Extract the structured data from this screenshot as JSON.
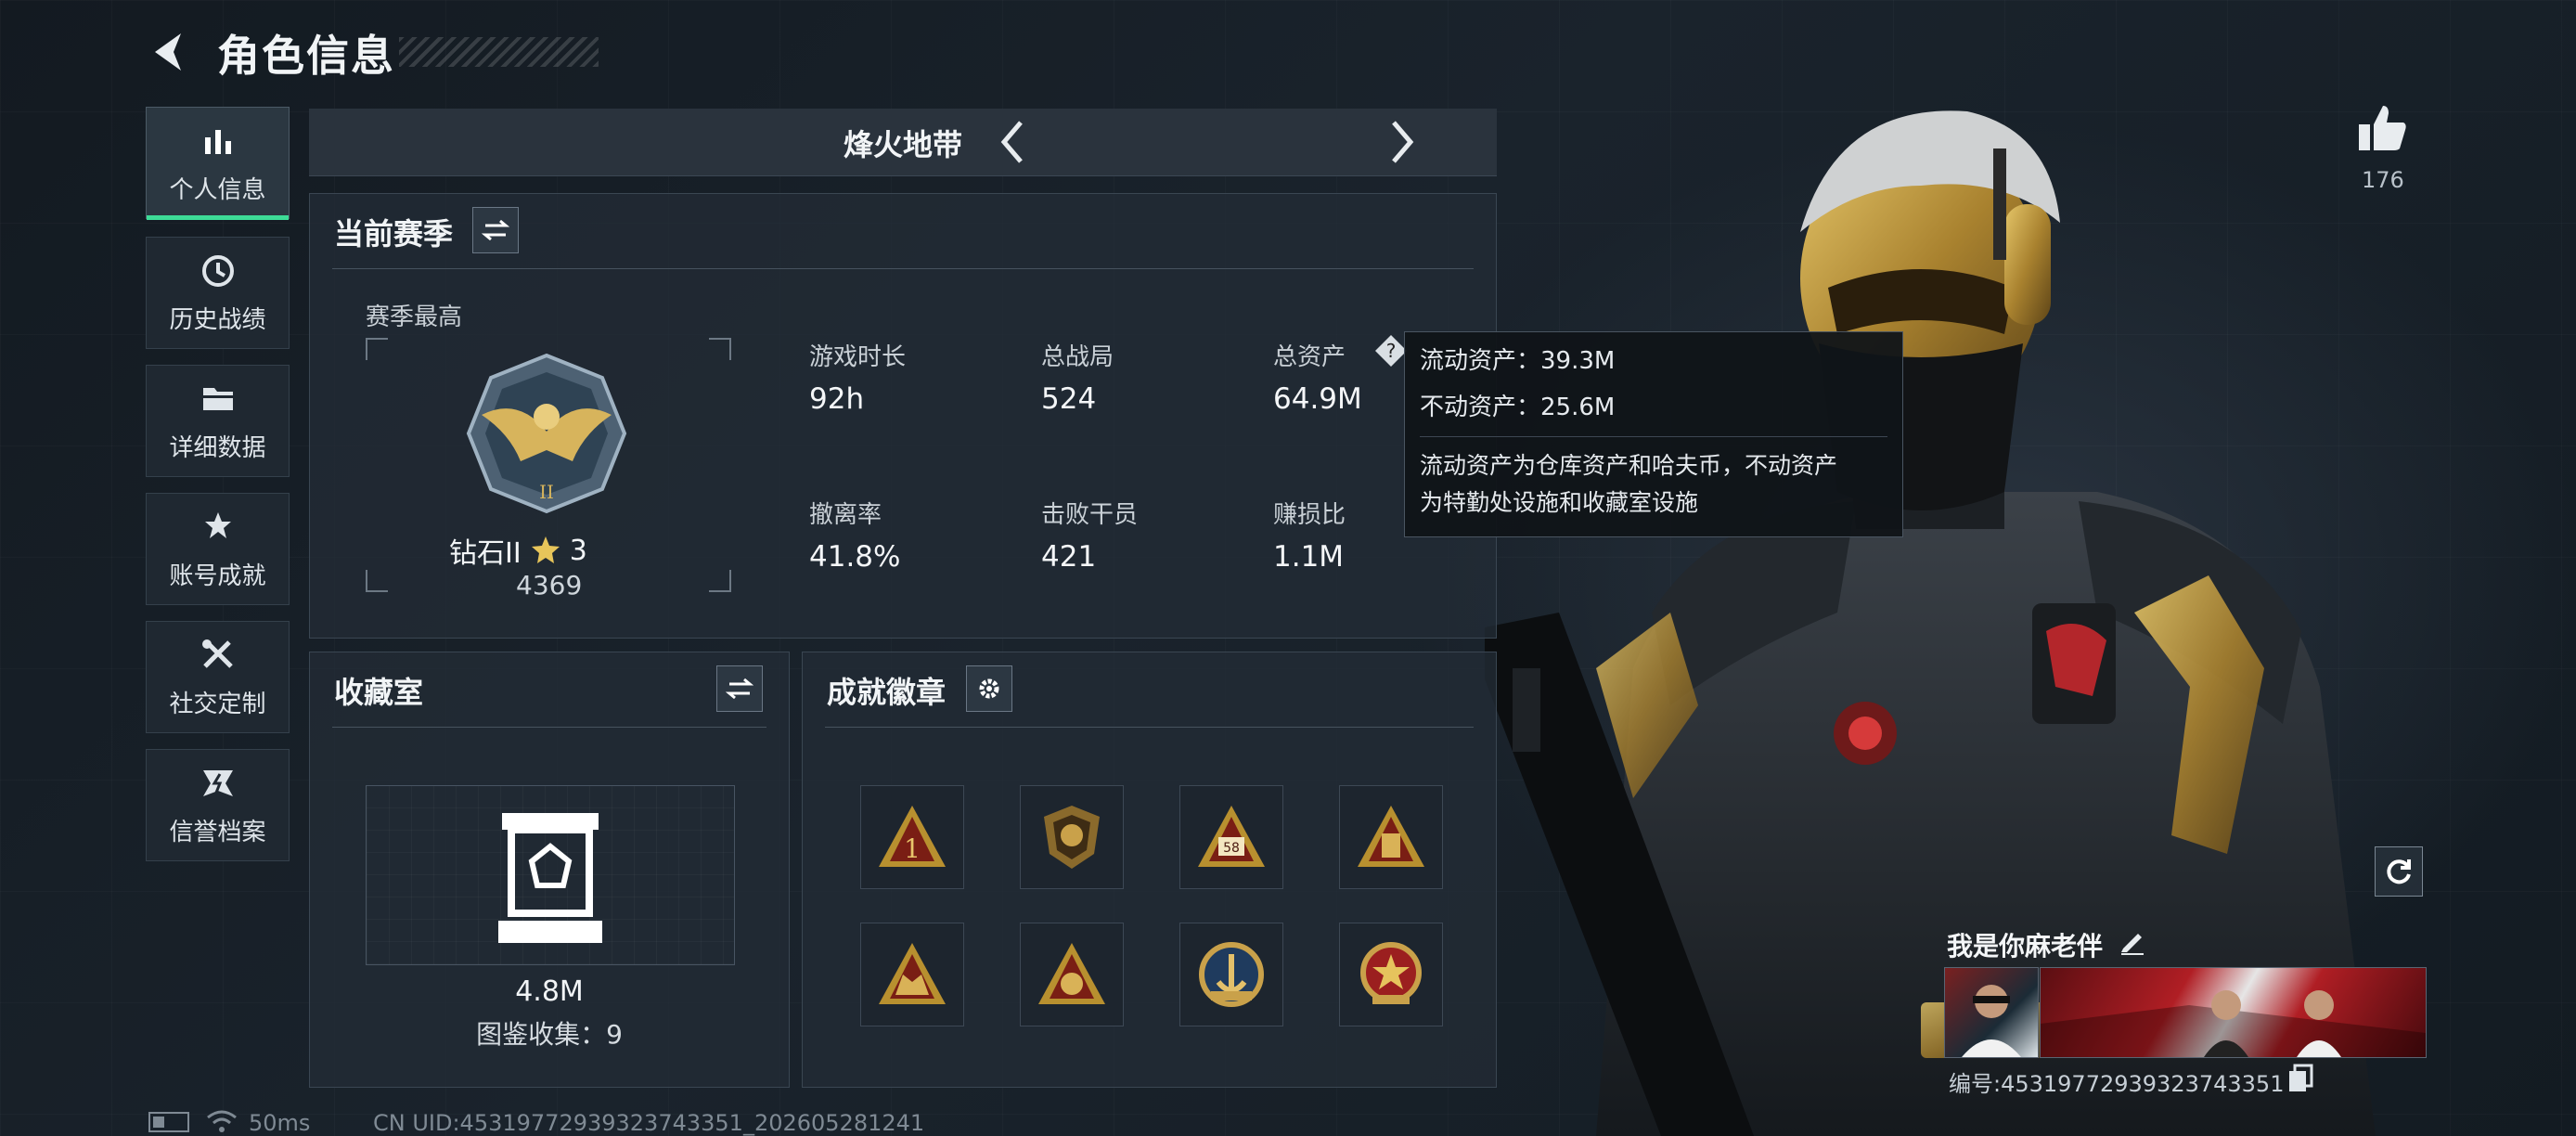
{
  "header": {
    "title": "角色信息"
  },
  "sidebar": {
    "items": [
      {
        "label": "个人信息",
        "icon": "bar-chart-icon",
        "active": true
      },
      {
        "label": "历史战绩",
        "icon": "clock-history-icon",
        "active": false
      },
      {
        "label": "详细数据",
        "icon": "folder-icon",
        "active": false
      },
      {
        "label": "账号成就",
        "icon": "achievement-icon",
        "active": false
      },
      {
        "label": "社交定制",
        "icon": "tools-icon",
        "active": false
      },
      {
        "label": "信誉档案",
        "icon": "reputation-icon",
        "active": false
      }
    ]
  },
  "mode": {
    "label": "烽火地带"
  },
  "season": {
    "title": "当前赛季",
    "best_label": "赛季最高",
    "rank_name": "钻石II",
    "rank_stars": "3",
    "rank_points": "4369",
    "stats": [
      {
        "label": "游戏时长",
        "value": "92h"
      },
      {
        "label": "总战局",
        "value": "524"
      },
      {
        "label": "总资产",
        "value": "64.9M"
      },
      {
        "label": "撤离率",
        "value": "41.8%"
      },
      {
        "label": "击败干员",
        "value": "421"
      },
      {
        "label": "赚损比",
        "value": "1.1M"
      }
    ]
  },
  "tooltip": {
    "liquid": "流动资产：39.3M",
    "fixed": "不动资产：25.6M",
    "note_line1": "流动资产为仓库资产和哈夫币，不动资产",
    "note_line2": "为特勤处设施和收藏室设施"
  },
  "collection": {
    "title": "收藏室",
    "value": "4.8M",
    "count_label": "图鉴收集：9"
  },
  "achievements": {
    "title": "成就徽章",
    "badges": [
      "rank-1-badge-icon",
      "lion-shield-badge-icon",
      "number-58-badge-icon",
      "tower-badge-icon",
      "squad-badge-icon",
      "helmet-badge-icon",
      "anchor-emblem-badge-icon",
      "star-emblem-badge-icon"
    ],
    "badge_58_text": "58",
    "badge_1_text": "1"
  },
  "player": {
    "likes": "176",
    "name": "我是你麻老伴",
    "id": "编号:4531977293932374335",
    "id_suffix": "1"
  },
  "footer": {
    "ping": "50ms",
    "uid": "CN UID:45319772939323743351_202605281241"
  },
  "colors": {
    "accent": "#3ddc97",
    "gold": "#c9a14a",
    "panel": "#222c36"
  }
}
